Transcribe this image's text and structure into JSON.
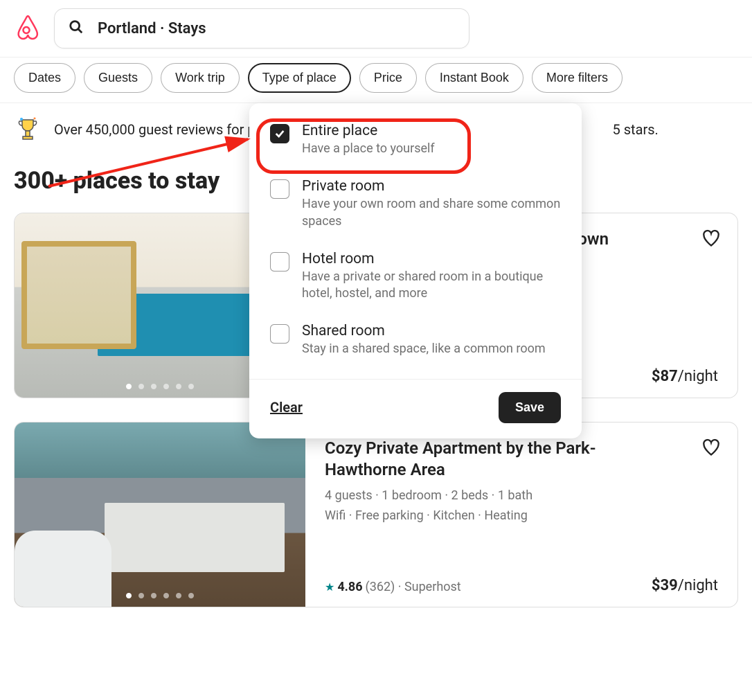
{
  "header": {
    "search_text": "Portland · Stays"
  },
  "filters": {
    "items": [
      "Dates",
      "Guests",
      "Work trip",
      "Type of place",
      "Price",
      "Instant Book",
      "More filters"
    ],
    "active_index": 3
  },
  "banner": {
    "text_left": "Over 450,000 guest reviews for p",
    "text_right": "5 stars."
  },
  "heading": "300+ places to stay",
  "dropdown": {
    "options": [
      {
        "title": "Entire place",
        "sub": "Have a place to yourself",
        "checked": true
      },
      {
        "title": "Private room",
        "sub": "Have your own room and share some common spaces",
        "checked": false
      },
      {
        "title": "Hotel room",
        "sub": "Have a private or shared room in a boutique hotel, hostel, and more",
        "checked": false
      },
      {
        "title": "Shared room",
        "sub": "Stay in a shared space, like a common room",
        "checked": false
      }
    ],
    "clear": "Clear",
    "save": "Save"
  },
  "listings": [
    {
      "title_suffix": "'town",
      "price": "$87",
      "price_unit": "/night"
    },
    {
      "title": "Cozy Private Apartment by the Park-Hawthorne Area",
      "meta1": "4 guests · 1 bedroom · 2 beds · 1 bath",
      "meta2": "Wifi · Free parking · Kitchen · Heating",
      "rating_score": "4.86",
      "rating_count": "(362)",
      "rating_suffix": " · Superhost",
      "price": "$39",
      "price_unit": "/night"
    }
  ]
}
